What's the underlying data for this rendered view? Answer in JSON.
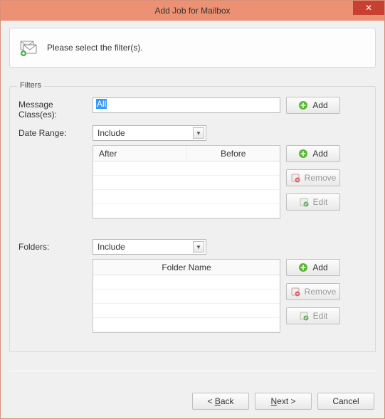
{
  "window": {
    "title": "Add Job for Mailbox"
  },
  "instruction": {
    "text": "Please select the filter(s)."
  },
  "filters": {
    "legend": "Filters",
    "messageClasses": {
      "label": "Message Class(es):",
      "value": "All",
      "addLabel": "Add"
    },
    "dateRange": {
      "label": "Date Range:",
      "mode": "Include",
      "columns": {
        "after": "After",
        "before": "Before"
      },
      "addLabel": "Add",
      "removeLabel": "Remove",
      "editLabel": "Edit"
    },
    "folders": {
      "label": "Folders:",
      "mode": "Include",
      "column": "Folder Name",
      "addLabel": "Add",
      "removeLabel": "Remove",
      "editLabel": "Edit"
    }
  },
  "footer": {
    "back": "< Back",
    "next": "Next >",
    "cancel": "Cancel"
  }
}
